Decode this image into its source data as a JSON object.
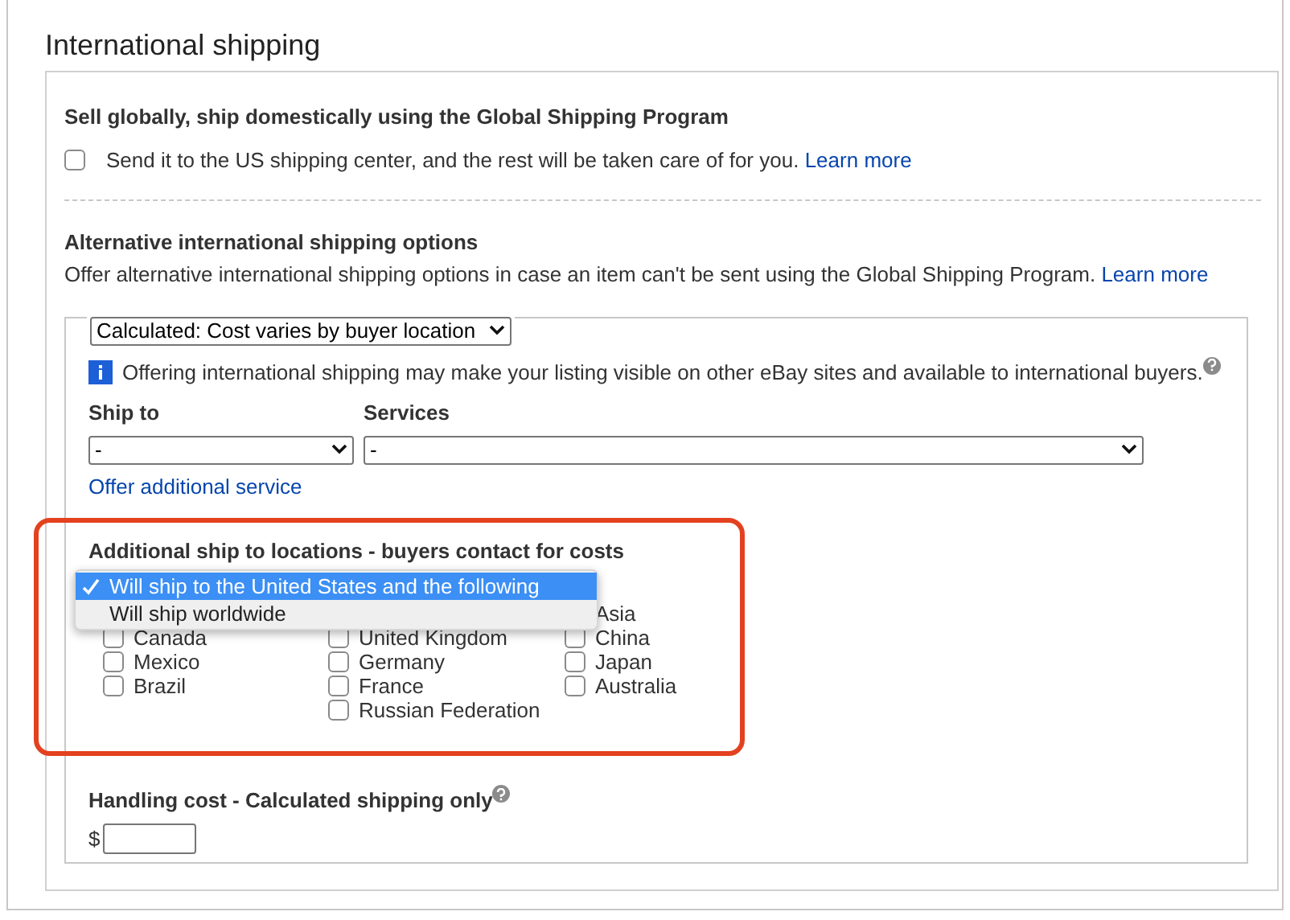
{
  "title": "International shipping",
  "global_shipping": {
    "heading": "Sell globally, ship domestically using the Global Shipping Program",
    "checked": false,
    "text": "Send it to the US shipping center, and the rest will be taken care of for you.",
    "link": "Learn more"
  },
  "alternative": {
    "heading": "Alternative international shipping options",
    "text": "Offer alternative international shipping options in case an item can't be sent using the Global Shipping Program.",
    "link": "Learn more",
    "cost_type": {
      "value": "Calculated: Cost varies by buyer location"
    },
    "info": "Offering international shipping may make your listing visible on other eBay sites and available to international buyers.",
    "ship_to": {
      "label": "Ship to",
      "value": "-"
    },
    "services": {
      "label": "Services",
      "value": "-"
    },
    "offer_link": "Offer additional service",
    "locations": {
      "heading": "Additional ship to locations - buyers contact for costs",
      "menu": [
        {
          "label": "Will ship to the United States and the following",
          "selected": true
        },
        {
          "label": "Will ship worldwide",
          "selected": false
        }
      ],
      "columns": [
        [
          {
            "label": "Canada",
            "checked": false
          },
          {
            "label": "Mexico",
            "checked": false
          },
          {
            "label": "Brazil",
            "checked": false
          }
        ],
        [
          {
            "label": "United Kingdom",
            "checked": false
          },
          {
            "label": "Germany",
            "checked": false
          },
          {
            "label": "France",
            "checked": false
          },
          {
            "label": "Russian Federation",
            "checked": false
          }
        ],
        [
          {
            "label": "Asia"
          },
          {
            "label": "China",
            "checked": false
          },
          {
            "label": "Japan",
            "checked": false
          },
          {
            "label": "Australia",
            "checked": false
          }
        ]
      ]
    },
    "handling": {
      "label": "Handling cost - Calculated shipping only",
      "currency": "$"
    }
  }
}
